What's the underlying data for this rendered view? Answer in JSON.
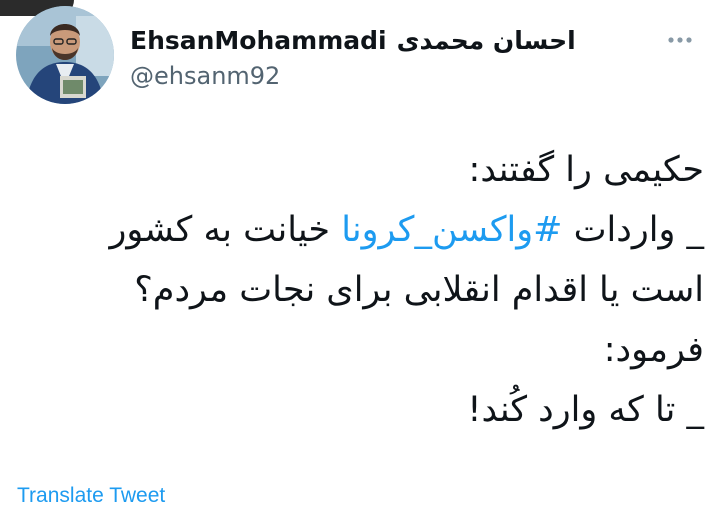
{
  "author": {
    "display_name": "EhsanMohammadi",
    "display_name_fa": "احسان محمدی",
    "handle": "@ehsanm92"
  },
  "menu": {
    "icon": "more-horizontal-icon"
  },
  "tweet": {
    "line1": "حکیمی را گفتند:",
    "line2_before": "_ واردات ",
    "line2_hashtag": "#واکسن_کرونا",
    "line2_after": "  خیانت به کشور",
    "line3": "است یا اقدام انقلابی برای نجات مردم؟",
    "line4": "فرمود:",
    "line5": "_ تا که وارد کُند!"
  },
  "footer": {
    "translate_label": "Translate Tweet"
  },
  "colors": {
    "link": "#1d9bf0",
    "text": "#0f1419",
    "secondary": "#536471"
  }
}
